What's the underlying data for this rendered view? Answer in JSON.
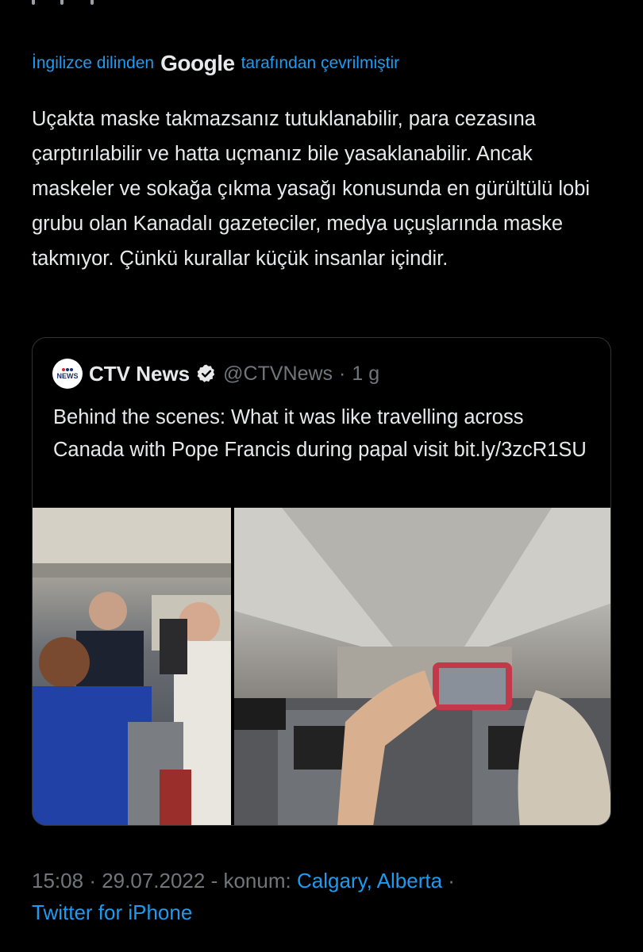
{
  "translation": {
    "prefix": "İngilizce dilinden",
    "provider": "Google",
    "suffix": "tarafından çevrilmiştir"
  },
  "tweet": {
    "text": "Uçakta maske takmazsanız tutuklanabilir, para cezasına çarptırılabilir ve hatta uçmanız bile yasaklanabilir. Ancak maskeler ve sokağa çıkma yasağı konusunda en gürültülü lobi grubu olan Kanadalı gazeteciler, medya uçuşlarında maske takmıyor. Çünkü kurallar küçük insanlar içindir."
  },
  "quoted": {
    "logo_text": "NEWS",
    "name": "CTV News",
    "handle": "@CTVNews",
    "separator": "·",
    "time": "1 g",
    "text": "Behind the scenes: What it was like travelling across Canada with Pope Francis during papal visit bit.ly/3zcR1SU"
  },
  "meta": {
    "time": "15:08",
    "sep1": "·",
    "date": "29.07.2022",
    "location_prefix": "- konum:",
    "location": "Calgary, Alberta",
    "sep2": "·",
    "source": "Twitter for iPhone"
  },
  "colors": {
    "background": "#000000",
    "text": "#e7e9ea",
    "muted": "#71767b",
    "link": "#1d9bf0",
    "border": "#2f3336"
  },
  "icons": [
    "verified-badge-icon",
    "ctv-news-logo"
  ]
}
